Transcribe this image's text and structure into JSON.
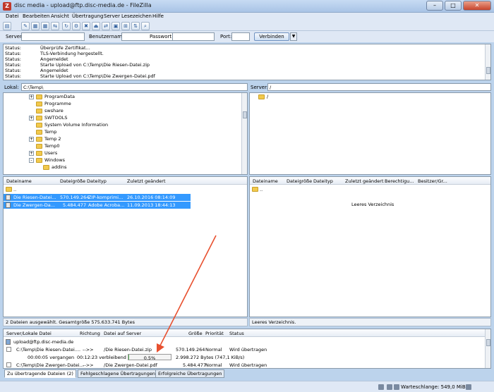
{
  "window": {
    "title": "disc media - upload@ftp.disc-media.de - FileZilla",
    "min": "–",
    "max": "□",
    "close": "✕"
  },
  "menu": [
    "Datei",
    "Bearbeiten",
    "Ansicht",
    "Übertragung",
    "Server",
    "Lesezeichen",
    "Hilfe"
  ],
  "quickconnect": {
    "server_label": "Server:",
    "user_label": "Benutzername:",
    "password_label": "Passwort:",
    "port_label": "Port:",
    "connect_label": "Verbinden"
  },
  "log": [
    {
      "k": "Status:",
      "v": "Überprüfe Zertifikat..."
    },
    {
      "k": "Status:",
      "v": "TLS-Verbindung hergestellt."
    },
    {
      "k": "Status:",
      "v": "Angemeldet"
    },
    {
      "k": "Status:",
      "v": "Starte Upload von C:\\Temp\\Die Riesen-Datei.zip"
    },
    {
      "k": "Status:",
      "v": "Angemeldet"
    },
    {
      "k": "Status:",
      "v": "Starte Upload von C:\\Temp\\Die Zwergen-Datei.pdf"
    }
  ],
  "local": {
    "label": "Lokal:",
    "path": "C:\\Temp\\",
    "tree": [
      {
        "name": "ProgramData",
        "exp": "+"
      },
      {
        "name": "Programme",
        "exp": ""
      },
      {
        "name": "swshare",
        "exp": ""
      },
      {
        "name": "SWTOOLS",
        "exp": "+"
      },
      {
        "name": "System Volume Information",
        "exp": ""
      },
      {
        "name": "Temp",
        "exp": ""
      },
      {
        "name": "Temp 2",
        "exp": "+"
      },
      {
        "name": "Temp0",
        "exp": ""
      },
      {
        "name": "Users",
        "exp": "+"
      },
      {
        "name": "Windows",
        "exp": "-"
      },
      {
        "name": "addins",
        "exp": ""
      }
    ],
    "headers": [
      "Dateiname",
      "Dateigröße",
      "Dateityp",
      "Zuletzt geändert"
    ],
    "files": [
      {
        "name": "..",
        "size": "",
        "type": "",
        "date": ""
      },
      {
        "name": "Die Riesen-Datei...",
        "size": "570.149.264",
        "type": "ZIP-komprimi...",
        "date": "26.10.2016 08:14:09"
      },
      {
        "name": "Die Zwergen-Da...",
        "size": "5.484.477",
        "type": "Adobe Acroba...",
        "date": "11.09.2013 18:44:13"
      }
    ],
    "status": "2 Dateien ausgewählt. Gesamtgröße 575.633.741 Bytes"
  },
  "remote": {
    "label": "Server:",
    "path": "/",
    "root": "/",
    "headers": [
      "Dateiname",
      "Dateigröße",
      "Dateityp",
      "Zuletzt geändert",
      "Berechtigu...",
      "Besitzer/Gr..."
    ],
    "parent": "..",
    "empty": "Leeres Verzeichnis",
    "status": "Leeres Verzeichnis."
  },
  "queue": {
    "headers": [
      "Server/Lokale Datei",
      "Richtung",
      "Datei auf Server",
      "Größe",
      "Priorität",
      "Status"
    ],
    "server": "upload@ftp.disc-media.de",
    "items": [
      {
        "local": "C:\\Temp\\Die Riesen-Datei....",
        "dir": "-->>",
        "remote": "/Die Riesen-Datei.zip",
        "size": "570.149.264",
        "prio": "Normal",
        "status": "Wird übertragen"
      },
      {
        "local": "C:\\Temp\\Die Zwergen-Datei...",
        "dir": "-->>",
        "remote": "/Die Zwergen-Datei.pdf",
        "size": "5.484.477",
        "prio": "Normal",
        "status": "Wird übertragen"
      }
    ],
    "progress": {
      "elapsed": "00:00:05 vergangen",
      "remaining": "00:12:23 verbleibend",
      "percent_label": "0.5%",
      "fraction": 0.005,
      "bytes": "2.998.272 Bytes (747,1 KiB/s)"
    }
  },
  "tabs": [
    "Zu übertragende Dateien (2)",
    "Fehlgeschlagene Übertragungen",
    "Erfolgreiche Übertragungen"
  ],
  "statusbar": {
    "queue": "Warteschlange: 549,0 MiB"
  },
  "colors": {
    "selection": "#3399ff",
    "arrow": "#e8502f"
  }
}
